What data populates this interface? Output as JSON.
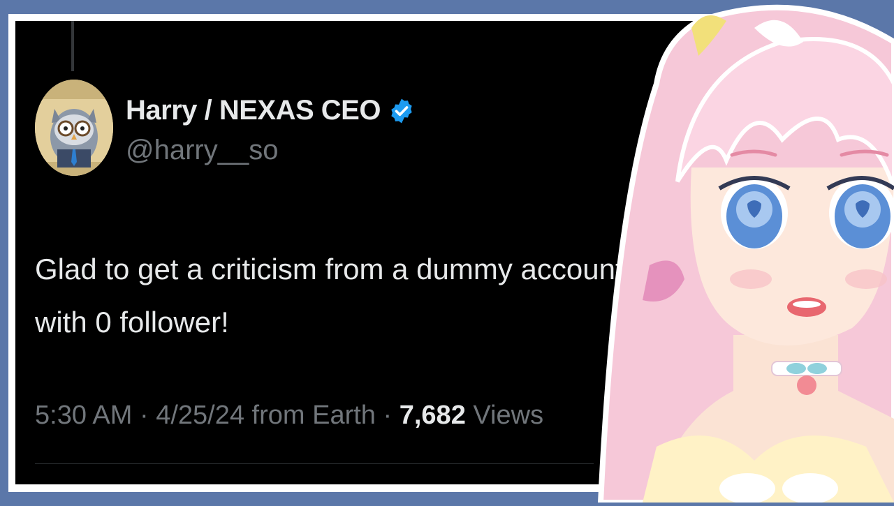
{
  "tweet": {
    "avatar_icon": "owl-avatar-icon",
    "display_name": "Harry / NEXAS CEO",
    "verified_icon": "verified-badge-icon",
    "handle": "@harry__so",
    "text_line1": "Glad to get a criticism from a dummy account",
    "text_line2": "with 0 follower!",
    "time": "5:30 AM",
    "separator": " · ",
    "date": "4/25/24",
    "source": " from Earth",
    "views_count": "7,682",
    "views_label": " Views"
  },
  "overlay": {
    "character": "pink-haired-anime-character-illustration"
  },
  "colors": {
    "background": "#5b77a9",
    "card": "#000000",
    "primary_text": "#e7e9ea",
    "secondary_text": "#71767b",
    "verified_blue": "#1d9bf0"
  }
}
